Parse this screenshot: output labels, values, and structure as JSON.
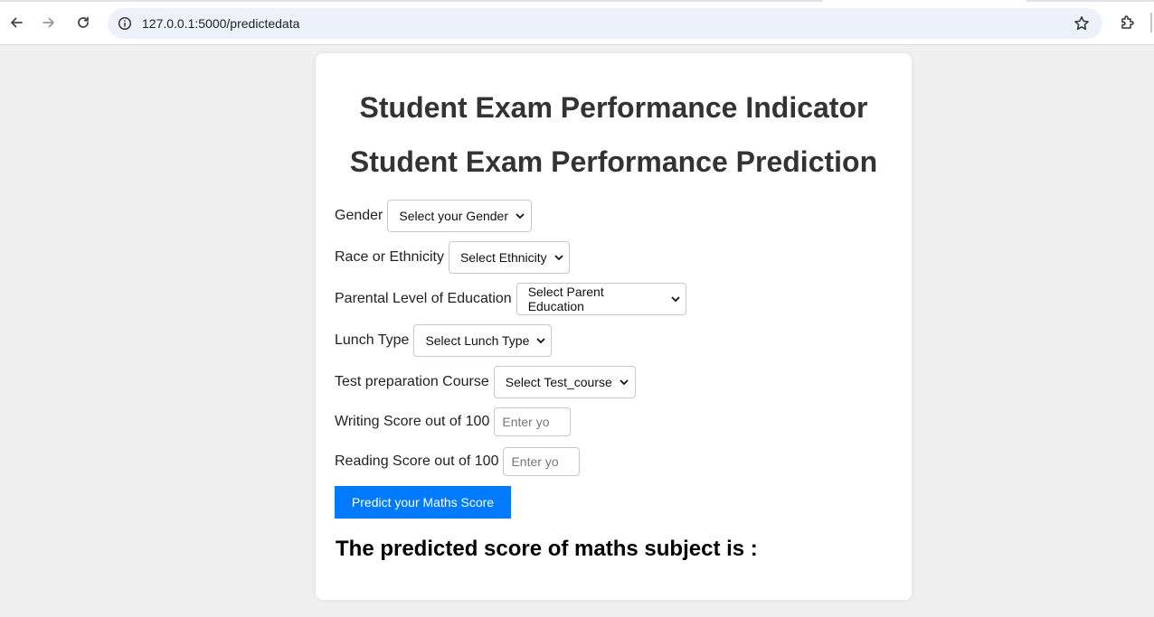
{
  "browser": {
    "url": "127.0.0.1:5000/predictedata"
  },
  "page": {
    "title": "Student Exam Performance Indicator",
    "subtitle": "Student Exam Performance Prediction",
    "fields": {
      "gender": {
        "label": "Gender",
        "selected": "Select your Gender"
      },
      "ethnicity": {
        "label": "Race or Ethnicity",
        "selected": "Select Ethnicity"
      },
      "parent_education": {
        "label": "Parental Level of Education",
        "selected": "Select Parent Education"
      },
      "lunch": {
        "label": "Lunch Type",
        "selected": "Select Lunch Type"
      },
      "test_course": {
        "label": "Test preparation Course",
        "selected": "Select Test_course"
      },
      "writing_score": {
        "label": "Writing Score out of 100",
        "placeholder": "Enter yo"
      },
      "reading_score": {
        "label": "Reading Score out of 100",
        "placeholder": "Enter yo"
      }
    },
    "submit_label": "Predict your Maths Score",
    "result_text": "The predicted score of maths subject is :"
  },
  "colors": {
    "button": "#007bff",
    "page_background": "#f0f0f0",
    "heading": "#333333"
  }
}
